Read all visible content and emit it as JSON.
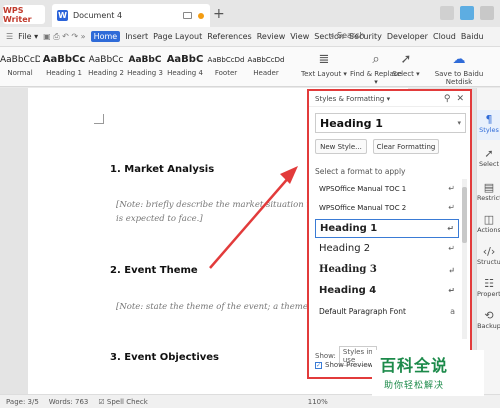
{
  "titlebar": {
    "app_tab": "WPS Writer",
    "doc_tab": "Document 4",
    "add_label": "+"
  },
  "menubar": {
    "file": "File ▾",
    "tabs": [
      "Home",
      "Insert",
      "Page Layout",
      "References",
      "Review",
      "View",
      "Section",
      "Security",
      "Developer",
      "Cloud",
      "Baidu"
    ],
    "search": "Search"
  },
  "ribbon": {
    "styles": [
      {
        "sample": "AaBbCcDd",
        "label": "Normal"
      },
      {
        "sample": "AaBbCc",
        "label": "Heading 1"
      },
      {
        "sample": "AaBbCc",
        "label": "Heading 2"
      },
      {
        "sample": "AaBbC",
        "label": "Heading 3"
      },
      {
        "sample": "AaBbC",
        "label": "Heading 4"
      },
      {
        "sample": "AaBbCcDd",
        "label": "Footer"
      },
      {
        "sample": "AaBbCcDd",
        "label": "Header"
      }
    ],
    "text_layout": "Text Layout ▾",
    "find_replace": "Find & Replace ▾",
    "select": "Select ▾",
    "save_baidu": "Save to Baidu Netdisk"
  },
  "document": {
    "heading1": "1. Market Analysis",
    "note1_line1": "[Note: briefly describe the market situation that the event",
    "note1_line2": "is expected to face.]",
    "heading2": "2. Event Theme",
    "note2": "[Note: state the theme of the event; a theme must be",
    "heading3": "3. Event Objectives"
  },
  "panel": {
    "title": "Styles & Formatting ▾",
    "current_style": "Heading 1",
    "new_style": "New Style...",
    "clear_format": "Clear Formatting",
    "pick_label": "Select a format to apply",
    "styles": [
      {
        "name": "WPSOffice Manual TOC 1",
        "mark": "↵"
      },
      {
        "name": "WPSOffice Manual TOC 2",
        "mark": "↵"
      },
      {
        "name": "Heading 1",
        "mark": "↵"
      },
      {
        "name": "Heading 2",
        "mark": "↵"
      },
      {
        "name": "Heading 3",
        "mark": "↵"
      },
      {
        "name": "Heading 4",
        "mark": "↵"
      },
      {
        "name": "Default Paragraph Font",
        "mark": "a"
      }
    ],
    "show_label": "Show:",
    "show_value": "Styles in use",
    "preview_label": "Show Preview"
  },
  "sidebar": {
    "items": [
      "Styles",
      "Select",
      "Restrict",
      "Actions",
      "Structure",
      "Properties",
      "Backup"
    ]
  },
  "statusbar": {
    "page": "Page: 3/5",
    "words": "Words: 763",
    "spell": "Spell Check",
    "zoom": "110%"
  },
  "watermark": {
    "title": "百科全说",
    "subtitle": "助你轻松解决"
  },
  "colors": {
    "accent": "#2f6bd8",
    "highlight": "#e23b3b",
    "watermark": "#1c8a4a"
  }
}
